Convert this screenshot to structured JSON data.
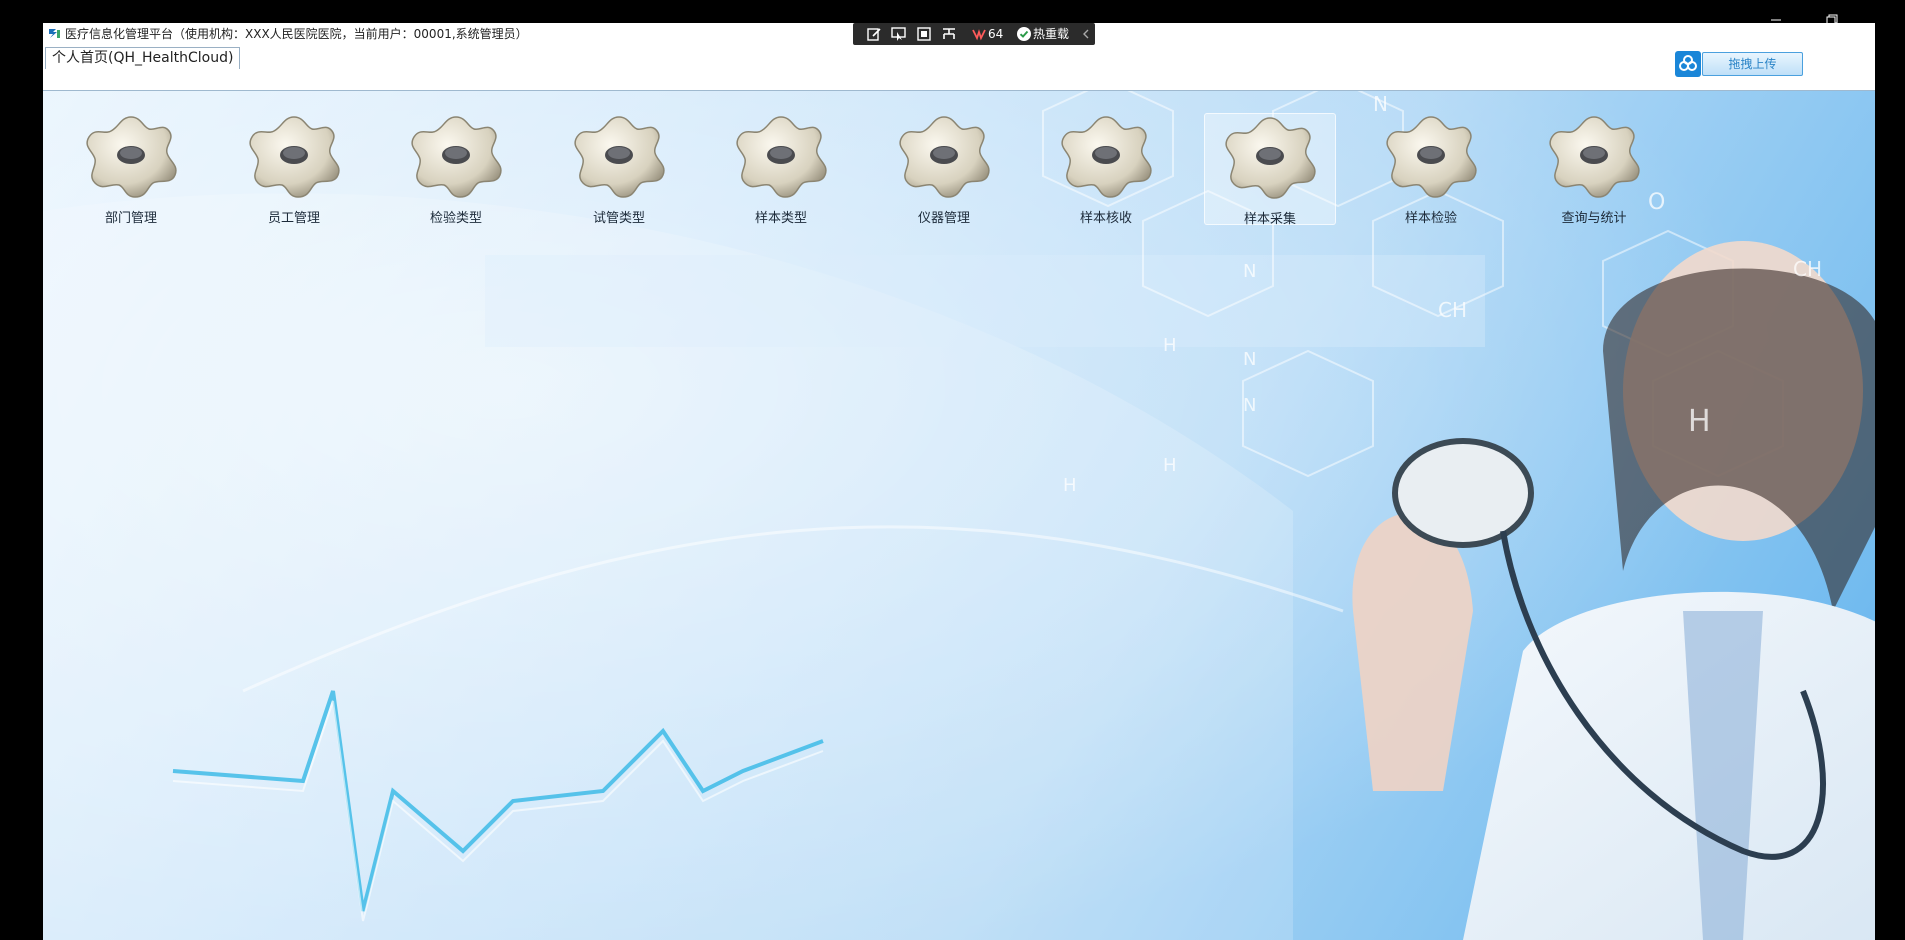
{
  "window": {
    "title": "医疗信息化管理平台（使用机构：XXX人民医院医院，当前用户：00001,系统管理员）"
  },
  "tabs": [
    {
      "label": "个人首页(QH_HealthCloud)"
    }
  ],
  "upload": {
    "label": "拖拽上传",
    "icon": "cloud-upload-icon"
  },
  "floating_toolbar": {
    "fps": "64",
    "status_label": "热重载"
  },
  "launchers": [
    {
      "label": "部门管理",
      "icon": "gear-icon",
      "selected": false
    },
    {
      "label": "员工管理",
      "icon": "gear-icon",
      "selected": false
    },
    {
      "label": "检验类型",
      "icon": "gear-icon",
      "selected": false
    },
    {
      "label": "试管类型",
      "icon": "gear-icon",
      "selected": false
    },
    {
      "label": "样本类型",
      "icon": "gear-icon",
      "selected": false
    },
    {
      "label": "仪器管理",
      "icon": "gear-icon",
      "selected": false
    },
    {
      "label": "样本核收",
      "icon": "gear-icon",
      "selected": false
    },
    {
      "label": "样本采集",
      "icon": "gear-icon",
      "selected": true
    },
    {
      "label": "样本检验",
      "icon": "gear-icon",
      "selected": false
    },
    {
      "label": "查询与统计",
      "icon": "gear-icon",
      "selected": false
    }
  ],
  "background_text": [
    "N",
    "N",
    "N",
    "N",
    "H",
    "H",
    "H",
    "H",
    "CH",
    "CH",
    "O"
  ],
  "colors": {
    "accent": "#1a86d8",
    "background": "#b3d9f6",
    "chrome": "#000000"
  }
}
